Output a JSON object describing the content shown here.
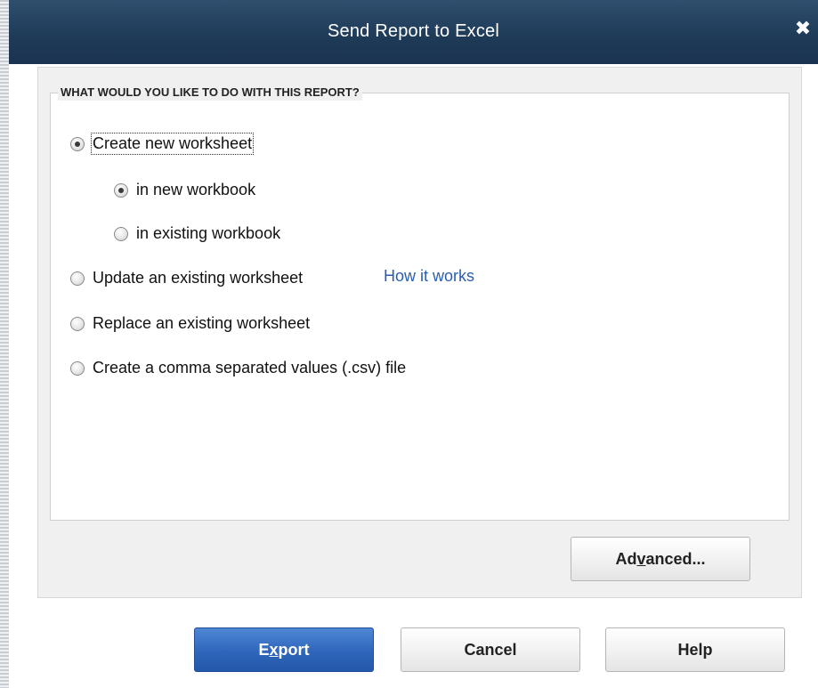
{
  "window": {
    "title": "Send Report to Excel",
    "close_glyph": "✖"
  },
  "group": {
    "caption": "WHAT WOULD YOU LIKE TO DO WITH THIS REPORT?"
  },
  "options": {
    "create_new": {
      "label": "Create new worksheet",
      "checked": true
    },
    "in_new_workbook": {
      "label": "in new workbook",
      "checked": true
    },
    "in_existing_workbook": {
      "label": "in existing workbook",
      "checked": false
    },
    "update_existing": {
      "label": "Update an existing worksheet",
      "checked": false
    },
    "replace_existing": {
      "label": "Replace an existing worksheet",
      "checked": false
    },
    "create_csv": {
      "label": "Create a comma separated values (.csv) file",
      "checked": false
    }
  },
  "links": {
    "how_it_works": "How it works"
  },
  "buttons": {
    "advanced": {
      "pre": "Ad",
      "mnemonic": "v",
      "post": "anced..."
    },
    "export": {
      "pre": "E",
      "mnemonic": "x",
      "post": "port"
    },
    "cancel": "Cancel",
    "help": "Help"
  },
  "colors": {
    "titlebar": "#1e3a57",
    "primary_button": "#2f66bb",
    "link": "#2a5db0"
  },
  "icons": {
    "close": "close-icon"
  }
}
